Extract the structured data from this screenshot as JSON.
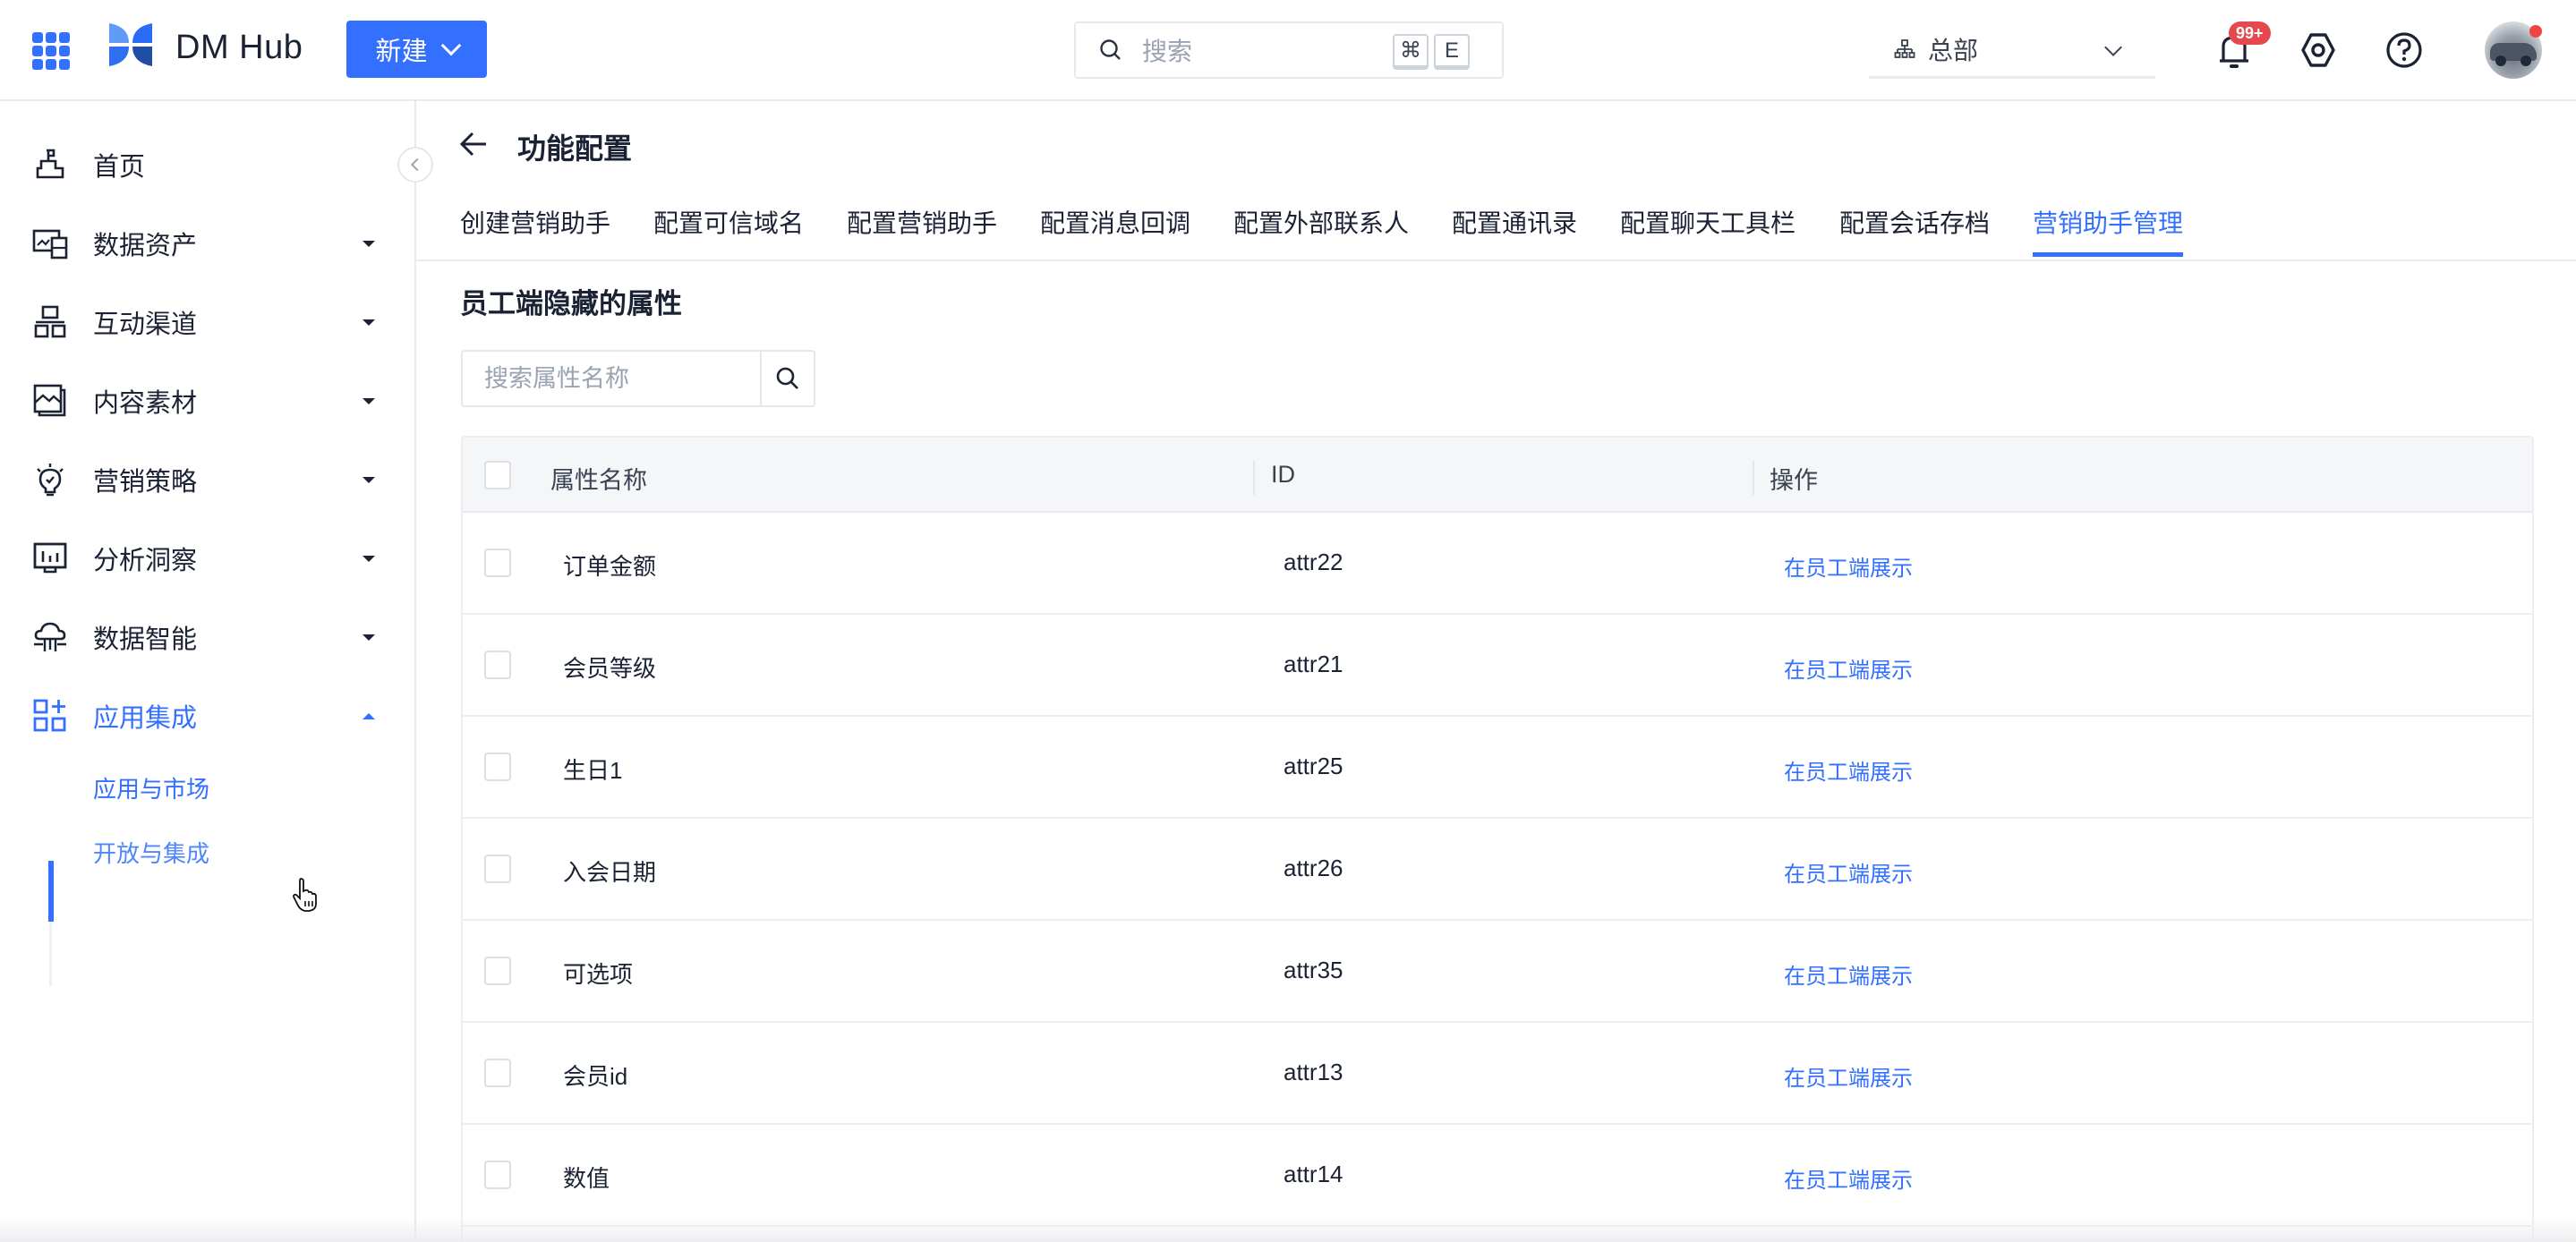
{
  "header": {
    "brand": "DM Hub",
    "new_button": "新建",
    "search_placeholder": "搜索",
    "shortcut_keys": [
      "⌘",
      "E"
    ],
    "org_selector": "总部",
    "notification_badge": "99+",
    "colors": {
      "accent": "#3370ff",
      "badge": "#e5484d"
    }
  },
  "sidebar": {
    "items": [
      {
        "label": "首页",
        "icon": "home-icon",
        "expandable": false
      },
      {
        "label": "数据资产",
        "icon": "data-assets-icon",
        "expandable": true
      },
      {
        "label": "互动渠道",
        "icon": "channels-icon",
        "expandable": true
      },
      {
        "label": "内容素材",
        "icon": "content-icon",
        "expandable": true
      },
      {
        "label": "营销策略",
        "icon": "strategy-bulb-icon",
        "expandable": true
      },
      {
        "label": "分析洞察",
        "icon": "analytics-icon",
        "expandable": true
      },
      {
        "label": "数据智能",
        "icon": "data-intelligence-icon",
        "expandable": true
      },
      {
        "label": "应用集成",
        "icon": "apps-integration-icon",
        "expandable": true,
        "expanded": true,
        "active": true
      }
    ],
    "sub_items": [
      {
        "label": "应用与市场",
        "active": true
      },
      {
        "label": "开放与集成",
        "active": false
      }
    ]
  },
  "page": {
    "title": "功能配置",
    "tabs": [
      {
        "label": "创建营销助手"
      },
      {
        "label": "配置可信域名"
      },
      {
        "label": "配置营销助手"
      },
      {
        "label": "配置消息回调"
      },
      {
        "label": "配置外部联系人"
      },
      {
        "label": "配置通讯录"
      },
      {
        "label": "配置聊天工具栏"
      },
      {
        "label": "配置会话存档"
      },
      {
        "label": "营销助手管理",
        "active": true
      }
    ],
    "section_title": "员工端隐藏的属性",
    "attr_search": {
      "placeholder": "搜索属性名称",
      "value": ""
    }
  },
  "table": {
    "columns": [
      "属性名称",
      "ID",
      "操作"
    ],
    "rows": [
      {
        "name": "订单金额",
        "id": "attr22",
        "action": "在员工端展示"
      },
      {
        "name": "会员等级",
        "id": "attr21",
        "action": "在员工端展示"
      },
      {
        "name": "生日1",
        "id": "attr25",
        "action": "在员工端展示"
      },
      {
        "name": "入会日期",
        "id": "attr26",
        "action": "在员工端展示"
      },
      {
        "name": "可选项",
        "id": "attr35",
        "action": "在员工端展示"
      },
      {
        "name": "会员id",
        "id": "attr13",
        "action": "在员工端展示"
      },
      {
        "name": "数值",
        "id": "attr14",
        "action": "在员工端展示"
      }
    ]
  }
}
